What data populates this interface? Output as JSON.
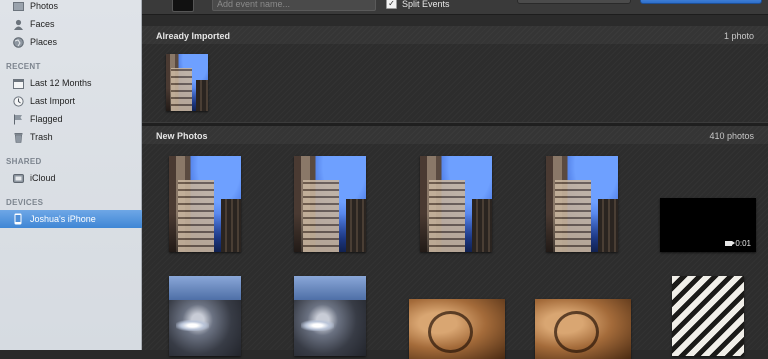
{
  "sidebar": {
    "library_items": [
      {
        "label": "Photos",
        "icon": "photos-icon"
      },
      {
        "label": "Faces",
        "icon": "faces-icon"
      },
      {
        "label": "Places",
        "icon": "places-icon"
      }
    ],
    "recent_header": "RECENT",
    "recent_items": [
      {
        "label": "Last 12 Months",
        "icon": "calendar-icon"
      },
      {
        "label": "Last Import",
        "icon": "clock-icon"
      },
      {
        "label": "Flagged",
        "icon": "flag-icon"
      },
      {
        "label": "Trash",
        "icon": "trash-icon"
      }
    ],
    "shared_header": "SHARED",
    "shared_items": [
      {
        "label": "iCloud",
        "icon": "icloud-icon"
      }
    ],
    "devices_header": "DEVICES",
    "device_items": [
      {
        "label": "Joshua's iPhone",
        "icon": "iphone-icon",
        "selected": true
      }
    ]
  },
  "toolbar": {
    "event_name_placeholder": "Add event name...",
    "split_events_label": "Split Events",
    "split_events_checked": true
  },
  "sections": {
    "already_imported": {
      "title": "Already Imported",
      "count": "1 photo"
    },
    "new_photos": {
      "title": "New Photos",
      "count": "410 photos"
    }
  },
  "video_duration": "0:01",
  "colors": {
    "selection": "#3f86d5",
    "import_button": "#2d6fcb",
    "sidebar_bg": "#dfe3e8",
    "content_bg": "#2d2d2d"
  }
}
